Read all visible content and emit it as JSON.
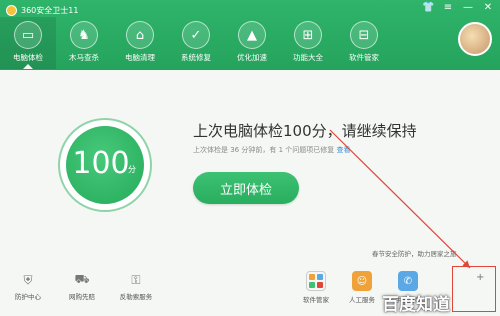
{
  "window": {
    "title": "360安全卫士11",
    "controls": [
      "minimize-icon",
      "skin-icon",
      "menu-icon",
      "close-icon"
    ]
  },
  "nav": {
    "items": [
      {
        "label": "电脑体检",
        "icon": "monitor-icon",
        "active": true
      },
      {
        "label": "木马查杀",
        "icon": "horse-icon",
        "active": false
      },
      {
        "label": "电脑清理",
        "icon": "broom-icon",
        "active": false
      },
      {
        "label": "系统修复",
        "icon": "shield-check-icon",
        "active": false
      },
      {
        "label": "优化加速",
        "icon": "rocket-icon",
        "active": false
      },
      {
        "label": "功能大全",
        "icon": "grid-icon",
        "active": false
      },
      {
        "label": "软件管家",
        "icon": "app-grid-icon",
        "active": false
      }
    ]
  },
  "main": {
    "score": "100",
    "score_unit": "分",
    "headline": "上次电脑体检100分，请继续保持",
    "subline_prefix": "上次体检是 36 分钟前，有 1 个问题项已修复 ",
    "subline_link": "查看",
    "check_button": "立即体检"
  },
  "promo": {
    "text": "春节安全防护，助力居家之旅"
  },
  "bottom_left": [
    {
      "label": "防护中心",
      "icon": "shield-icon"
    },
    {
      "label": "网购先赔",
      "icon": "cart-icon"
    },
    {
      "label": "反勒索服务",
      "icon": "lock-icon"
    }
  ],
  "bottom_right": [
    {
      "label": "软件管家",
      "icon": "app-grid-icon",
      "color": "#ffffff"
    },
    {
      "label": "人工服务",
      "icon": "support-person-icon",
      "color": "#f0a23a"
    },
    {
      "label": "手机助手",
      "icon": "phone-assistant-icon",
      "color": "#5aa9e6"
    }
  ],
  "more": {
    "label": "+"
  },
  "watermark": {
    "text": "百度知道"
  },
  "colors": {
    "brand_green": "#2fb46a",
    "button_green": "#29ad5f",
    "annotation_red": "#e2463a"
  }
}
